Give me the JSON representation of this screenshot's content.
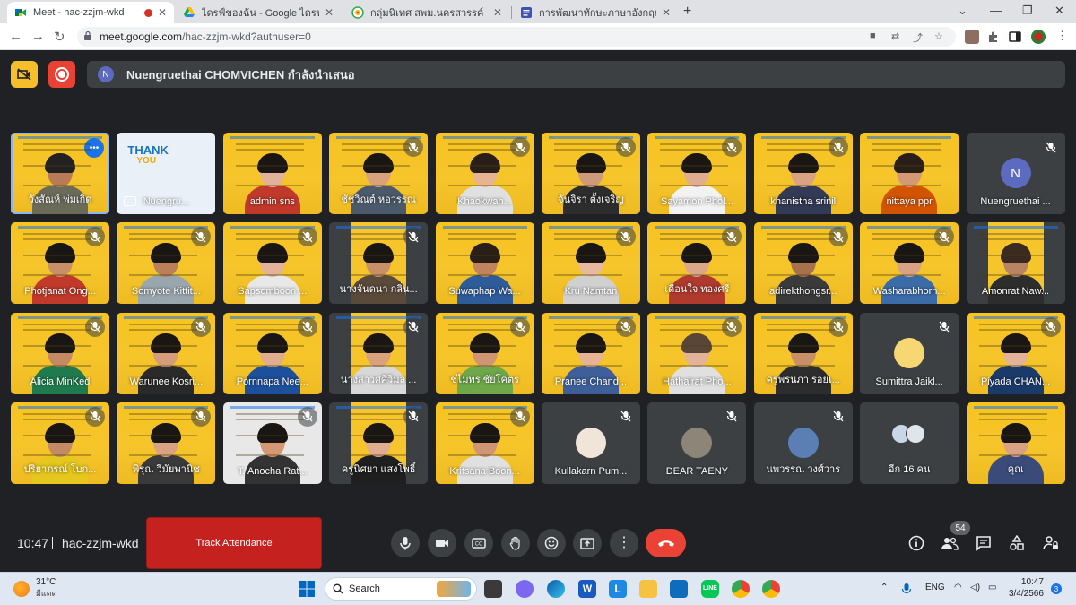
{
  "browser": {
    "tabs": [
      {
        "title": "Meet - hac-zzjm-wkd",
        "icon": "google-meet-icon",
        "active": true,
        "recording": true
      },
      {
        "title": "ไดรฟ์ของฉัน - Google ไดรฟ์",
        "icon": "google-drive-icon",
        "active": false
      },
      {
        "title": "กลุ่มนิเทศ สพม.นครสวรรค์",
        "icon": "group-icon",
        "active": false
      },
      {
        "title": "การพัฒนาทักษะภาษาอังกฤษ English",
        "icon": "google-forms-icon",
        "active": false
      }
    ],
    "url_host": "meet.google.com",
    "url_path": "/hac-zzjm-wkd?authuser=0"
  },
  "meet": {
    "presenter_initial": "N",
    "presenting_banner": "Nuengruethai CHOMVICHEN กำลังนำเสนอ",
    "participants": [
      {
        "name": "วังสัณห์ พ่มเกิด",
        "kind": "video",
        "muted": false,
        "pinned_menu": true,
        "skin": "#b97a56",
        "hair": "#222",
        "shirt": "#6b6b5a"
      },
      {
        "name": "Nuengru...",
        "kind": "thankyou",
        "muted": false,
        "presenting": true,
        "thank_title": "THANK",
        "thank_sub": "YOU"
      },
      {
        "name": "admin sns",
        "kind": "video",
        "muted": false,
        "skin": "#e2b398",
        "hair": "#1a1613",
        "shirt": "#c0392b"
      },
      {
        "name": "ชัชวิณต์ หอวรรณ",
        "kind": "video",
        "muted": true,
        "skin": "#d9a27c",
        "hair": "#1a1613",
        "shirt": "#4a5a6a"
      },
      {
        "name": "Khaokwan...",
        "kind": "video",
        "muted": true,
        "skin": "#e6b493",
        "hair": "#2a1f18",
        "shirt": "#e0e0e0"
      },
      {
        "name": "จันจิรา ตั้งเจริญ",
        "kind": "video",
        "muted": true,
        "skin": "#cf9a7a",
        "hair": "#1a1613",
        "shirt": "#2d2d2d"
      },
      {
        "name": "Sayamon Phol...",
        "kind": "video",
        "muted": true,
        "skin": "#e0ad90",
        "hair": "#1a1613",
        "shirt": "#f2f2f2"
      },
      {
        "name": "khanistha srinil",
        "kind": "video",
        "muted": true,
        "skin": "#d8a283",
        "hair": "#1a1613",
        "shirt": "#333a55"
      },
      {
        "name": "nittaya ppr",
        "kind": "video",
        "muted": false,
        "skin": "#d49874",
        "hair": "#2a1f18",
        "shirt": "#d35400"
      },
      {
        "name": "Nuengruethai ...",
        "kind": "avatar",
        "muted": true,
        "initial": "N",
        "avatar_color": "#5c6bc0"
      },
      {
        "name": "Photjanat Ong...",
        "kind": "video",
        "muted": true,
        "skin": "#c98f66",
        "hair": "#1a1613",
        "shirt": "#c0392b"
      },
      {
        "name": "Somyote Kittit...",
        "kind": "video",
        "muted": true,
        "skin": "#b9805a",
        "hair": "#1a1613",
        "shirt": "#9aa6ad"
      },
      {
        "name": "Sapsomboon ...",
        "kind": "video",
        "muted": true,
        "skin": "#e2b398",
        "hair": "#1a1613",
        "shirt": "#e8e8e8"
      },
      {
        "name": "นางจันดนา กลิ่น...",
        "kind": "video",
        "muted": true,
        "dark": true,
        "skin": "#c98f66",
        "hair": "#1a1613",
        "shirt": "#5a4a3a"
      },
      {
        "name": "Suwaphap Wa...",
        "kind": "video",
        "muted": false,
        "skin": "#c0835e",
        "hair": "#2a1f18",
        "shirt": "#2e5c9a"
      },
      {
        "name": "Kru Namtan",
        "kind": "video",
        "muted": true,
        "skin": "#e7b99e",
        "hair": "#1a1613",
        "shirt": "#d0d0d0"
      },
      {
        "name": "เดือนใจ ทองศรี",
        "kind": "video",
        "muted": true,
        "skin": "#dca789",
        "hair": "#1a1613",
        "shirt": "#b03a2e"
      },
      {
        "name": "adirekthongsr...",
        "kind": "video",
        "muted": true,
        "skin": "#a9704c",
        "hair": "#1a1613",
        "shirt": "#3a3a3a"
      },
      {
        "name": "Washarabhorn...",
        "kind": "video",
        "muted": true,
        "skin": "#d8a283",
        "hair": "#1a1613",
        "shirt": "#3c6ca8"
      },
      {
        "name": "Amonrat Naw...",
        "kind": "video",
        "muted": false,
        "dark": true,
        "skin": "#b98463",
        "hair": "#3a2a1f",
        "shirt": "#2d2d2d"
      },
      {
        "name": "Alicia MinKed",
        "kind": "video",
        "muted": true,
        "skin": "#c48a63",
        "hair": "#1a1613",
        "shirt": "#1f7a4d"
      },
      {
        "name": "Warunee Kosri...",
        "kind": "video",
        "muted": true,
        "skin": "#d39c7b",
        "hair": "#1a1613",
        "shirt": "#2a2a2a"
      },
      {
        "name": "Pornnapa Nee...",
        "kind": "video",
        "muted": true,
        "skin": "#e0ad90",
        "hair": "#1a1613",
        "shirt": "#1c4f9c"
      },
      {
        "name": "นางสาวศศิวิมล ...",
        "kind": "video",
        "muted": true,
        "dark": true,
        "skin": "#d9a27c",
        "hair": "#1a1613",
        "shirt": "#d8d8d8"
      },
      {
        "name": "ชไมพร ชัยโคตร",
        "kind": "video",
        "muted": true,
        "skin": "#d09673",
        "hair": "#1a1613",
        "shirt": "#6ea84a"
      },
      {
        "name": "Pranee Chand...",
        "kind": "video",
        "muted": true,
        "skin": "#e6b493",
        "hair": "#1a1613",
        "shirt": "#3e5f9a"
      },
      {
        "name": "Hathairat Pho...",
        "kind": "video",
        "muted": true,
        "skin": "#e2b398",
        "hair": "#5a4636",
        "shirt": "#e0e0e0"
      },
      {
        "name": "ครูพรนภา รอยเ...",
        "kind": "video",
        "muted": true,
        "skin": "#c98f66",
        "hair": "#1a1613",
        "shirt": "#2d2d2d"
      },
      {
        "name": "Sumittra Jaikl...",
        "kind": "avatar",
        "muted": true,
        "initial": "",
        "avatar_color": "#f7d774"
      },
      {
        "name": "Piyada CHAN...",
        "kind": "video",
        "muted": true,
        "skin": "#e2b398",
        "hair": "#1a1613",
        "shirt": "#1a3a6a"
      },
      {
        "name": "ปริยาภรณ์ โบก...",
        "kind": "video",
        "muted": true,
        "skin": "#c48a63",
        "hair": "#1a1613",
        "shirt": "#e6c71d"
      },
      {
        "name": "พิรุณ วิมัยพานิช",
        "kind": "video",
        "muted": true,
        "skin": "#d8a283",
        "hair": "#1a1613",
        "shirt": "#3a3a3a"
      },
      {
        "name": "T. Anocha Rat...",
        "kind": "video",
        "muted": true,
        "light": true,
        "skin": "#d49874",
        "hair": "#1a1613",
        "shirt": "#333"
      },
      {
        "name": "ครูนิศยา แสงโพธิ์",
        "kind": "video",
        "muted": true,
        "dark": true,
        "skin": "#e0ad90",
        "hair": "#1a1613",
        "shirt": "#1f1f1f"
      },
      {
        "name": "Kritsana Boon...",
        "kind": "video",
        "muted": true,
        "skin": "#d09673",
        "hair": "#1a1613",
        "shirt": "#e0e0e0"
      },
      {
        "name": "Kullakarn Pum...",
        "kind": "avatar",
        "muted": true,
        "initial": "",
        "avatar_color": "#f1e4d8"
      },
      {
        "name": "DEAR TAENY",
        "kind": "avatar",
        "muted": true,
        "initial": "",
        "avatar_color": "#8d8577"
      },
      {
        "name": "นพวรรณ วงศ์วาร",
        "kind": "avatar",
        "muted": true,
        "initial": "",
        "avatar_color": "#5b7fb5"
      },
      {
        "name": "อีก 16 คน",
        "kind": "more",
        "muted": false
      },
      {
        "name": "คุณ",
        "kind": "video",
        "muted": false,
        "self": true,
        "skin": "#d8a283",
        "hair": "#1a1613",
        "shirt": "#3a4b7a"
      }
    ]
  },
  "bottom": {
    "time": "10:47",
    "meeting_code": "hac-zzjm-wkd",
    "track_attendance": "Track Attendance",
    "participant_count": "54"
  },
  "taskbar": {
    "temperature": "31°C",
    "condition": "มีแดด",
    "search_label": "Search",
    "lang": "ENG",
    "time": "10:47",
    "date": "3/4/2566",
    "notifications": "3"
  }
}
